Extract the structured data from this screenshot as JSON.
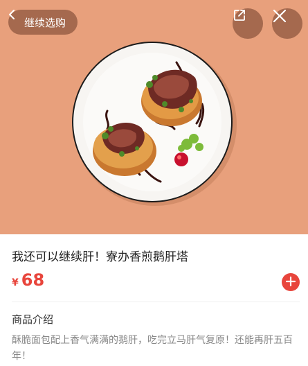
{
  "header": {
    "back_label": "继续选购",
    "back_icon": "chevron-left-icon",
    "share_icon": "share-icon",
    "close_icon": "close-icon",
    "hero_background": "#E8A07C"
  },
  "product": {
    "title": "我还可以继续肝！寮办香煎鹅肝塔",
    "currency": "¥",
    "price": "68",
    "add_icon": "plus-icon",
    "accent_color": "#E8453C"
  },
  "details": {
    "section_title": "商品介绍",
    "description": "酥脆面包配上香气满满的鹅肝，吃完立马肝气复原！还能再肝五百年！"
  }
}
